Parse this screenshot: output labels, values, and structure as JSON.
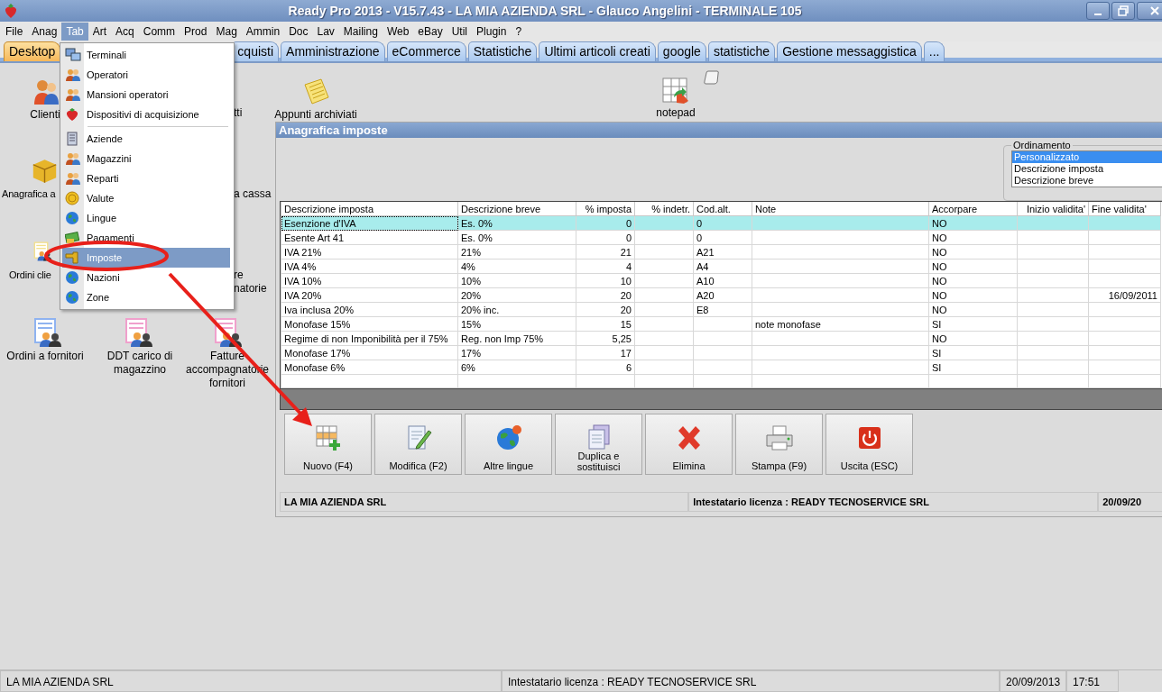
{
  "window": {
    "title": "Ready Pro 2013 - V15.7.43 - LA MIA AZIENDA SRL - Glauco Angelini - TERMINALE 105"
  },
  "menubar": [
    {
      "label": "File",
      "selected": false
    },
    {
      "label": "Anag",
      "selected": false
    },
    {
      "label": "Tab",
      "selected": true
    },
    {
      "label": "Art",
      "selected": false
    },
    {
      "label": "Acq",
      "selected": false
    },
    {
      "label": "Comm",
      "selected": false
    },
    {
      "label": "Prod",
      "selected": false
    },
    {
      "label": "Mag",
      "selected": false
    },
    {
      "label": "Ammin",
      "selected": false
    },
    {
      "label": "Doc",
      "selected": false
    },
    {
      "label": "Lav",
      "selected": false
    },
    {
      "label": "Mailing",
      "selected": false
    },
    {
      "label": "Web",
      "selected": false
    },
    {
      "label": "eBay",
      "selected": false
    },
    {
      "label": "Util",
      "selected": false
    },
    {
      "label": "Plugin",
      "selected": false
    },
    {
      "label": "?",
      "selected": false
    }
  ],
  "tabs": [
    {
      "label": "Desktop",
      "selected": true
    },
    {
      "label": "cquisti",
      "selected": false
    },
    {
      "label": "Amministrazione",
      "selected": false
    },
    {
      "label": "eCommerce",
      "selected": false
    },
    {
      "label": "Statistiche",
      "selected": false
    },
    {
      "label": "Ultimi articoli creati",
      "selected": false
    },
    {
      "label": "google",
      "selected": false
    },
    {
      "label": "statistiche",
      "selected": false
    },
    {
      "label": "Gestione messaggistica",
      "selected": false
    },
    {
      "label": "...",
      "selected": false
    }
  ],
  "dropdown": {
    "groups": [
      {
        "items": [
          {
            "label": "Terminali",
            "selected": false
          },
          {
            "label": "Operatori",
            "selected": false
          },
          {
            "label": "Mansioni operatori",
            "selected": false
          },
          {
            "label": "Dispositivi di acquisizione",
            "selected": false
          }
        ]
      },
      {
        "items": [
          {
            "label": "Aziende",
            "selected": false
          },
          {
            "label": "Magazzini",
            "selected": false
          },
          {
            "label": "Reparti",
            "selected": false
          },
          {
            "label": "Valute",
            "selected": false
          },
          {
            "label": "Lingue",
            "selected": false
          },
          {
            "label": "Pagamenti",
            "selected": false
          },
          {
            "label": "Imposte",
            "selected": true
          },
          {
            "label": "Nazioni",
            "selected": false
          },
          {
            "label": "Zone",
            "selected": false
          }
        ]
      }
    ]
  },
  "desktop_icons": [
    "Clienti",
    "tti",
    "Appunti archiviati",
    "notepad",
    "Anagrafica a",
    "a cassa",
    "Ordini clie",
    "re natorie",
    "Ordini a fornitori",
    "DDT carico di magazzino",
    "Fatture accompagnatorie fornitori"
  ],
  "child_window": {
    "title": "Anagrafica imposte",
    "ordering": {
      "title": "Ordinamento",
      "options": [
        {
          "label": "Personalizzato",
          "selected": true
        },
        {
          "label": "Descrizione imposta",
          "selected": false
        },
        {
          "label": "Descrizione breve",
          "selected": false
        }
      ]
    },
    "table": {
      "columns": [
        "Descrizione imposta",
        "Descrizione breve",
        "% imposta",
        "% indetr.",
        "Cod.alt.",
        "Note",
        "Accorpare",
        "Inizio validita'",
        "Fine validita'"
      ],
      "rows": [
        {
          "selected": true,
          "cells": [
            "Esenzione d'IVA",
            "Es. 0%",
            "0",
            "",
            "0",
            "",
            "NO",
            "",
            ""
          ]
        },
        {
          "selected": false,
          "cells": [
            "Esente Art 41",
            "Es. 0%",
            "0",
            "",
            "0",
            "",
            "NO",
            "",
            ""
          ]
        },
        {
          "selected": false,
          "cells": [
            "IVA 21%",
            "21%",
            "21",
            "",
            "A21",
            "",
            "NO",
            "",
            ""
          ]
        },
        {
          "selected": false,
          "cells": [
            "IVA 4%",
            "4%",
            "4",
            "",
            "A4",
            "",
            "NO",
            "",
            ""
          ]
        },
        {
          "selected": false,
          "cells": [
            "IVA 10%",
            "10%",
            "10",
            "",
            "A10",
            "",
            "NO",
            "",
            ""
          ]
        },
        {
          "selected": false,
          "cells": [
            "IVA 20%",
            "20%",
            "20",
            "",
            "A20",
            "",
            "NO",
            "",
            "16/09/2011"
          ]
        },
        {
          "selected": false,
          "cells": [
            "Iva inclusa 20%",
            "20% inc.",
            "20",
            "",
            "E8",
            "",
            "NO",
            "",
            ""
          ]
        },
        {
          "selected": false,
          "cells": [
            "Monofase 15%",
            "15%",
            "15",
            "",
            "",
            "note monofase",
            "SI",
            "",
            ""
          ]
        },
        {
          "selected": false,
          "cells": [
            "Regime di non Imponibilità per il 75%",
            "Reg. non Imp 75%",
            "5,25",
            "",
            "",
            "",
            "NO",
            "",
            ""
          ]
        },
        {
          "selected": false,
          "cells": [
            "Monofase 17%",
            "17%",
            "17",
            "",
            "",
            "",
            "SI",
            "",
            ""
          ]
        },
        {
          "selected": false,
          "cells": [
            "Monofase 6%",
            "6%",
            "6",
            "",
            "",
            "",
            "SI",
            "",
            ""
          ]
        }
      ]
    },
    "buttons": [
      "Nuovo (F4)",
      "Modifica (F2)",
      "Altre lingue",
      "Duplica e sostituisci",
      "Elimina",
      "Stampa (F9)",
      "Uscita (ESC)"
    ],
    "status": [
      "LA MIA AZIENDA SRL",
      "Intestatario licenza : READY TECNOSERVICE SRL",
      "20/09/20"
    ]
  },
  "status_bar": [
    "LA MIA AZIENDA SRL",
    "Intestatario licenza : READY TECNOSERVICE SRL",
    "20/09/2013",
    "17:51"
  ]
}
